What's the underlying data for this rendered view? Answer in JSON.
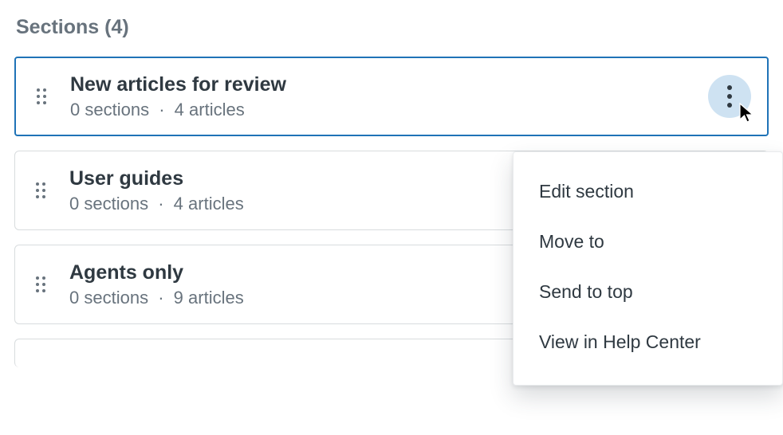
{
  "heading": {
    "label": "Sections",
    "count": 4
  },
  "sections_word": "sections",
  "articles_word": "articles",
  "sections": [
    {
      "title": "New articles for review",
      "sections_count": 0,
      "articles_count": 4,
      "selected": true,
      "menu_open": true
    },
    {
      "title": "User guides",
      "sections_count": 0,
      "articles_count": 4,
      "selected": false,
      "menu_open": false
    },
    {
      "title": "Agents only",
      "sections_count": 0,
      "articles_count": 9,
      "selected": false,
      "menu_open": false
    }
  ],
  "menu": {
    "items": [
      "Edit section",
      "Move to",
      "Send to top",
      "View in Help Center"
    ]
  }
}
